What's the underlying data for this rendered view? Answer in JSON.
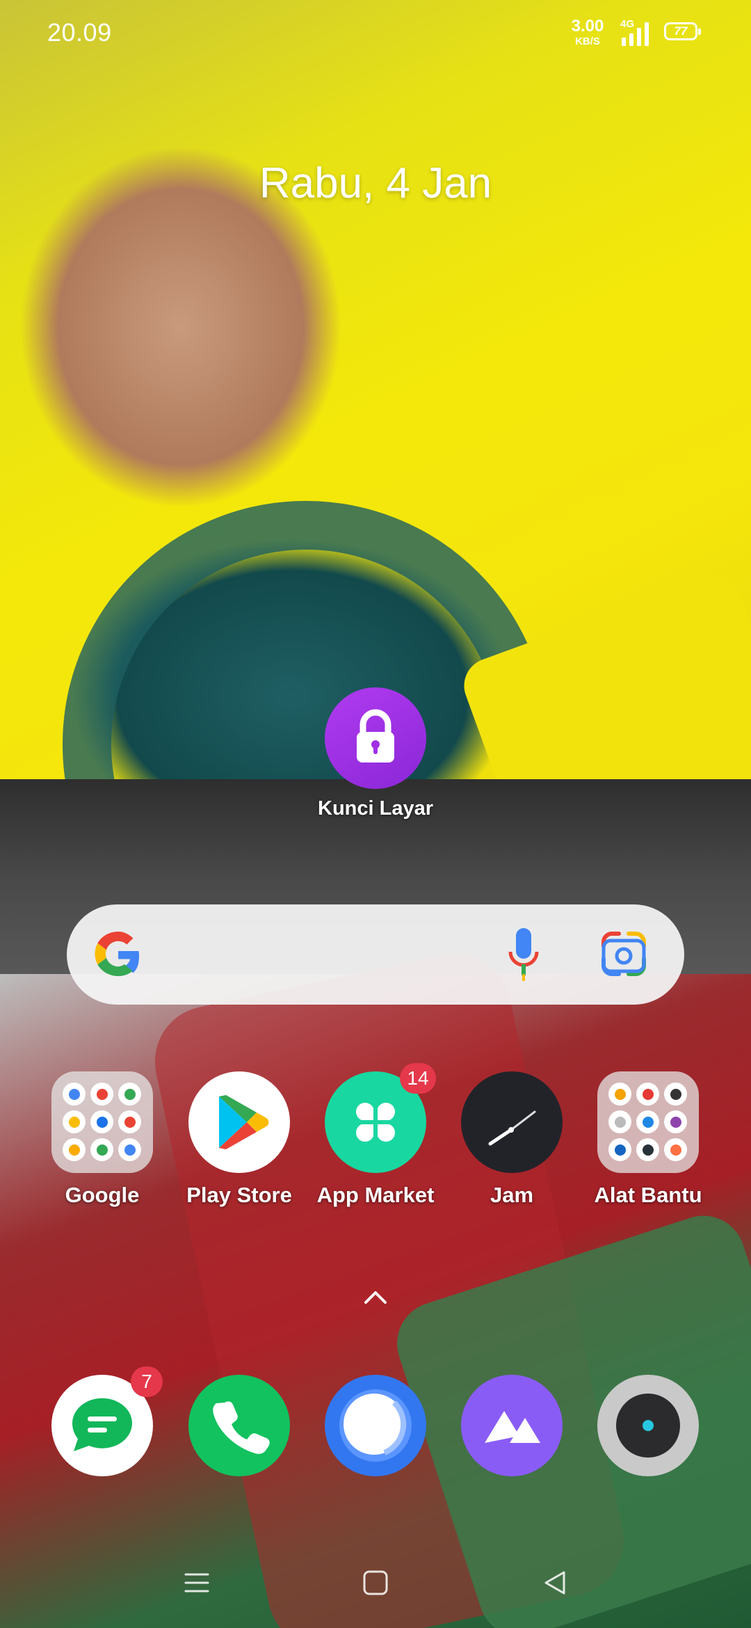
{
  "status_bar": {
    "time": "20.09",
    "net_speed_value": "3.00",
    "net_speed_unit": "KB/S",
    "network_type": "4G",
    "battery_level": "77"
  },
  "home": {
    "date": "Rabu, 4 Jan"
  },
  "lock_widget": {
    "label": "Kunci Layar",
    "icon": "lock-icon"
  },
  "search_bar": {
    "icons": [
      "google-g-icon",
      "microphone-icon",
      "google-lens-icon"
    ]
  },
  "apps": [
    {
      "label": "Google",
      "icon": "google-folder"
    },
    {
      "label": "Play Store",
      "icon": "play-store-icon"
    },
    {
      "label": "App Market",
      "icon": "app-market-icon",
      "badge": "14"
    },
    {
      "label": "Jam",
      "icon": "clock-icon"
    },
    {
      "label": "Alat Bantu",
      "icon": "tools-folder"
    }
  ],
  "dock": [
    {
      "name": "messages",
      "icon": "messages-icon",
      "badge": "7",
      "color": "#12b75a"
    },
    {
      "name": "phone",
      "icon": "phone-icon",
      "color": "#12c25e"
    },
    {
      "name": "browser",
      "icon": "browser-icon",
      "color": "#3277f0"
    },
    {
      "name": "gallery",
      "icon": "gallery-icon",
      "color": "#8a5cf6"
    },
    {
      "name": "camera",
      "icon": "camera-icon",
      "color": "#c9c9c9"
    }
  ],
  "navigation": [
    "menu-icon",
    "home-icon",
    "back-icon"
  ]
}
